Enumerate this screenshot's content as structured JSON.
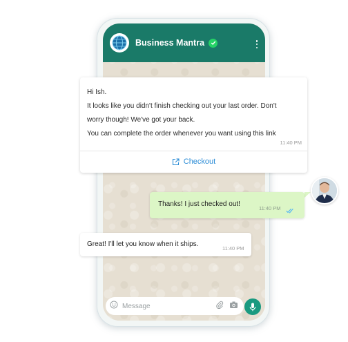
{
  "header": {
    "title": "Business Mantra",
    "logo_icon": "globe-logo-icon",
    "verified_icon": "verified-check-icon",
    "menu_icon": "kebab-menu-icon",
    "color": "#1a7a68"
  },
  "messages": [
    {
      "direction": "incoming",
      "lines": [
        "Hi Ish.",
        "It looks like you didn't finish checking out your last order. Don't",
        "worry though! We've got your back.",
        "You can complete the order whenever you want using this link"
      ],
      "time": "11:40 PM",
      "cta": {
        "label": "Checkout",
        "icon": "external-link-icon"
      }
    },
    {
      "direction": "outgoing",
      "text": "Thanks! I just checked out!",
      "time": "11:40 PM",
      "status_icon": "double-check-read-icon"
    },
    {
      "direction": "incoming",
      "text": "Great! I'll let you know when it ships.",
      "time": "11:40 PM"
    }
  ],
  "composer": {
    "placeholder": "Message",
    "emoji_icon": "emoji-icon",
    "attach_icon": "paperclip-icon",
    "camera_icon": "camera-icon",
    "mic_icon": "microphone-icon"
  },
  "colors": {
    "outgoing_bubble": "#dcf6c6",
    "link": "#2b8cd6",
    "read_ticks": "#4fb3f6"
  }
}
